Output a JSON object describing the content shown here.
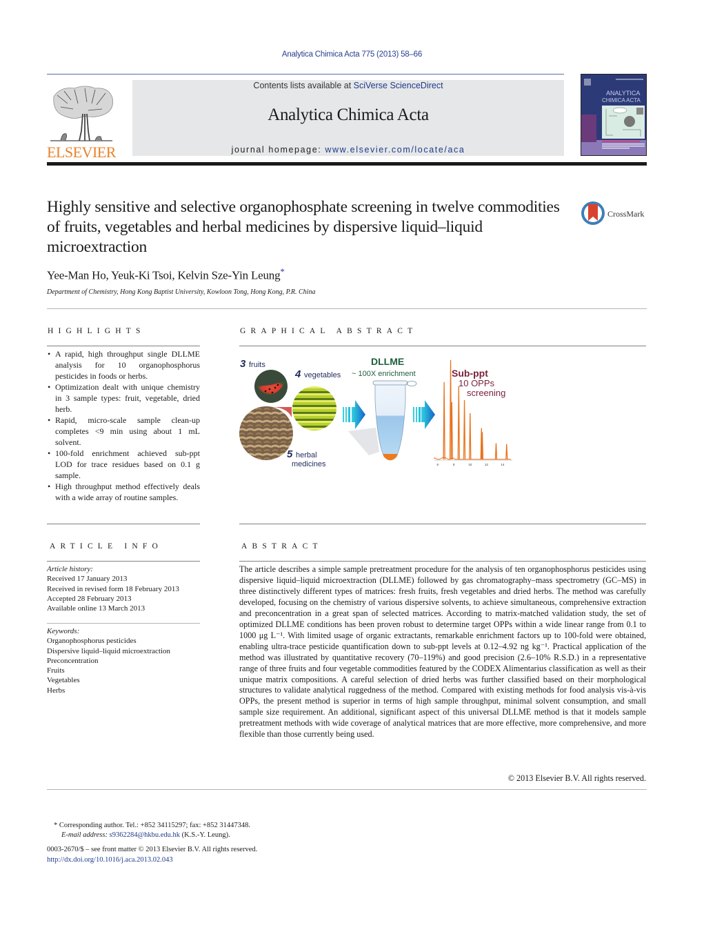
{
  "header": {
    "journal_citation": "Analytica Chimica Acta 775 (2013) 58–66",
    "contents_prefix": "Contents lists available at ",
    "contents_link": "SciVerse ScienceDirect",
    "journal_name": "Analytica Chimica Acta",
    "homepage_prefix": "journal homepage: ",
    "homepage_link": "www.elsevier.com/locate/aca",
    "publisher_logo_text": "ELSEVIER",
    "cover_title_line1": "ANALYTICA",
    "cover_title_line2": "CHIMICA ACTA",
    "colors": {
      "publisher_orange": "#e8822a",
      "link_blue": "#1e3a8a",
      "header_box_gray": "#e6e7e8",
      "cover_navy": "#2c3a78"
    }
  },
  "article": {
    "title": "Highly sensitive and selective organophosphate screening in twelve commodities of fruits, vegetables and herbal medicines by dispersive liquid–liquid microextraction",
    "crossmark_label": "CrossMark",
    "authors": "Yee-Man Ho, Yeuk-Ki Tsoi, Kelvin Sze-Yin Leung",
    "author_mark": "*",
    "affiliation": "Department of Chemistry, Hong Kong Baptist University, Kowloon Tong, Hong Kong, P.R. China"
  },
  "highlights": {
    "heading": "HIGHLIGHTS",
    "items": [
      "A rapid, high throughput single DLLME analysis for 10 organophosphorus pesticides in foods or herbs.",
      "Optimization dealt with unique chemistry in 3 sample types: fruit, vegetable, dried herb.",
      "Rapid, micro-scale sample clean-up completes <9 min using about 1 mL solvent.",
      "100-fold enrichment achieved sub-ppt LOD for trace residues based on 0.1 g sample.",
      "High throughput method effectively deals with a wide array of routine samples."
    ]
  },
  "graphical_abstract": {
    "heading": "GRAPHICAL ABSTRACT",
    "fruits_num": "3",
    "fruits_label": "fruits",
    "veg_num": "4",
    "veg_label": "vegetables",
    "herb_num": "5",
    "herb_label1": "herbal",
    "herb_label2": "medicines",
    "dllme_title": "DLLME",
    "dllme_sub": "~ 100X enrichment",
    "result_title": "Sub-ppt",
    "result_line1": "10 OPPs",
    "result_line2": "screening",
    "chromatogram_ticks": [
      "6",
      "8",
      "10",
      "12",
      "14"
    ],
    "chromatogram_peaks": [
      {
        "t": 6.8,
        "h": 0.78
      },
      {
        "t": 7.6,
        "h": 1.0
      },
      {
        "t": 7.75,
        "h": 0.58
      },
      {
        "t": 8.6,
        "h": 0.74
      },
      {
        "t": 9.3,
        "h": 0.6
      },
      {
        "t": 10.0,
        "h": 0.47
      },
      {
        "t": 11.4,
        "h": 0.32
      },
      {
        "t": 11.5,
        "h": 0.28
      },
      {
        "t": 13.2,
        "h": 0.17
      },
      {
        "t": 14.5,
        "h": 0.16
      }
    ],
    "colors": {
      "num_navy": "#1f2a5a",
      "dllme_green": "#1e5e3c",
      "result_maroon": "#7a1f3a",
      "peak_orange": "#e8731e",
      "arrow_blue": "#1aa3d9"
    }
  },
  "article_info": {
    "heading": "ARTICLE INFO",
    "history_label": "Article history:",
    "history": [
      "Received 17 January 2013",
      "Received in revised form 18 February 2013",
      "Accepted 28 February 2013",
      "Available online 13 March 2013"
    ],
    "keywords_label": "Keywords:",
    "keywords": [
      "Organophosphorus pesticides",
      "Dispersive liquid–liquid microextraction",
      "Preconcentration",
      "Fruits",
      "Vegetables",
      "Herbs"
    ]
  },
  "abstract": {
    "heading": "ABSTRACT",
    "text": "The article describes a simple sample pretreatment procedure for the analysis of ten organophosphorus pesticides using dispersive liquid–liquid microextraction (DLLME) followed by gas chromatography–mass spectrometry (GC–MS) in three distinctively different types of matrices: fresh fruits, fresh vegetables and dried herbs. The method was carefully developed, focusing on the chemistry of various dispersive solvents, to achieve simultaneous, comprehensive extraction and preconcentration in a great span of selected matrices. According to matrix-matched validation study, the set of optimized DLLME conditions has been proven robust to determine target OPPs within a wide linear range from 0.1 to 1000 μg L⁻¹. With limited usage of organic extractants, remarkable enrichment factors up to 100-fold were obtained, enabling ultra-trace pesticide quantification down to sub-ppt levels at 0.12–4.92 ng kg⁻¹. Practical application of the method was illustrated by quantitative recovery (70–119%) and good precision (2.6–10% R.S.D.) in a representative range of three fruits and four vegetable commodities featured by the CODEX Alimentarius classification as well as their unique matrix compositions. A careful selection of dried herbs was further classified based on their morphological structures to validate analytical ruggedness of the method. Compared with existing methods for food analysis vis-à-vis OPPs, the present method is superior in terms of high sample throughput, minimal solvent consumption, and small sample size requirement. An additional, significant aspect of this universal DLLME method is that it models sample pretreatment methods with wide coverage of analytical matrices that are more effective, more comprehensive, and more flexible than those currently being used.",
    "copyright": "© 2013 Elsevier B.V. All rights reserved."
  },
  "footer": {
    "corr_mark": "*",
    "corr_text": " Corresponding author. Tel.: +852 34115297; fax: +852 31447348.",
    "email_label": "E-mail address:",
    "email": "s9362284@hkbu.edu.hk",
    "email_suffix": " (K.S.-Y. Leung).",
    "issn_line": "0003-2670/$ – see front matter © 2013 Elsevier B.V. All rights reserved.",
    "doi": "http://dx.doi.org/10.1016/j.aca.2013.02.043"
  }
}
